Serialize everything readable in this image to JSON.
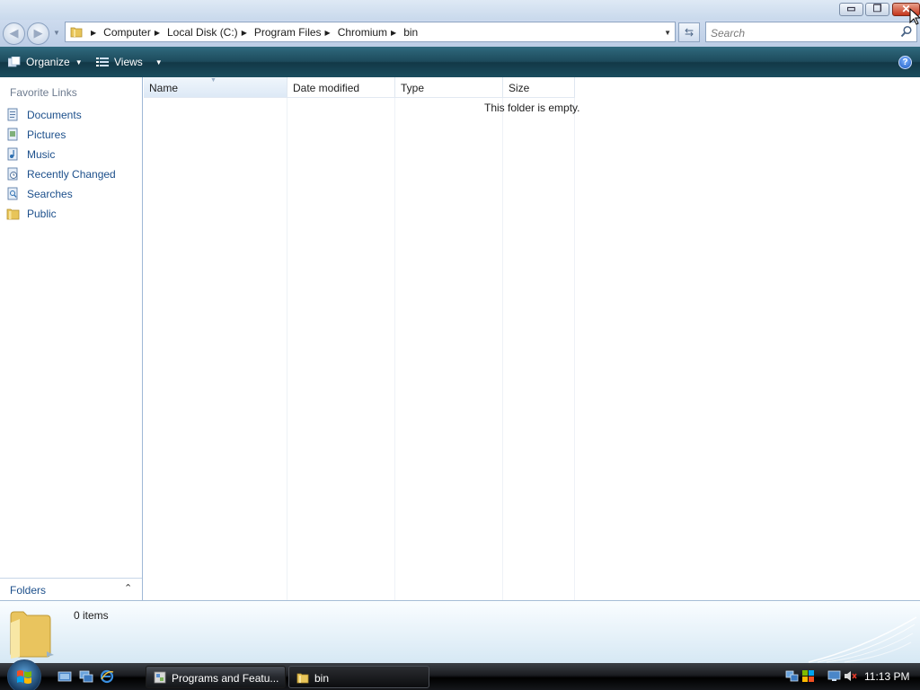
{
  "window": {
    "controls": {
      "minimize": "▭",
      "restore": "❐",
      "close": "✕"
    }
  },
  "nav": {
    "back_icon": "back-arrow-icon",
    "forward_icon": "forward-arrow-icon",
    "breadcrumbs": [
      "Computer",
      "Local Disk (C:)",
      "Program Files",
      "Chromium",
      "bin"
    ],
    "search_placeholder": "Search"
  },
  "command_bar": {
    "organize": "Organize",
    "views": "Views",
    "help": "?"
  },
  "sidebar": {
    "favorite_links_title": "Favorite Links",
    "items": [
      {
        "label": "Documents",
        "icon": "documents-icon"
      },
      {
        "label": "Pictures",
        "icon": "pictures-icon"
      },
      {
        "label": "Music",
        "icon": "music-icon"
      },
      {
        "label": "Recently Changed",
        "icon": "recently-changed-icon"
      },
      {
        "label": "Searches",
        "icon": "searches-icon"
      },
      {
        "label": "Public",
        "icon": "public-folder-icon"
      }
    ],
    "folders_label": "Folders"
  },
  "file_list": {
    "columns": [
      "Name",
      "Date modified",
      "Type",
      "Size"
    ],
    "empty_message": "This folder is empty."
  },
  "details": {
    "count": "0 items"
  },
  "taskbar": {
    "tasks": [
      {
        "label": "Programs and Featu...",
        "active": false
      },
      {
        "label": "bin",
        "active": true
      }
    ],
    "clock": "11:13 PM"
  },
  "colors": {
    "command_bar": "#1d4a5c",
    "link_blue": "#1c4f8b",
    "close_red": "#c4361c"
  }
}
